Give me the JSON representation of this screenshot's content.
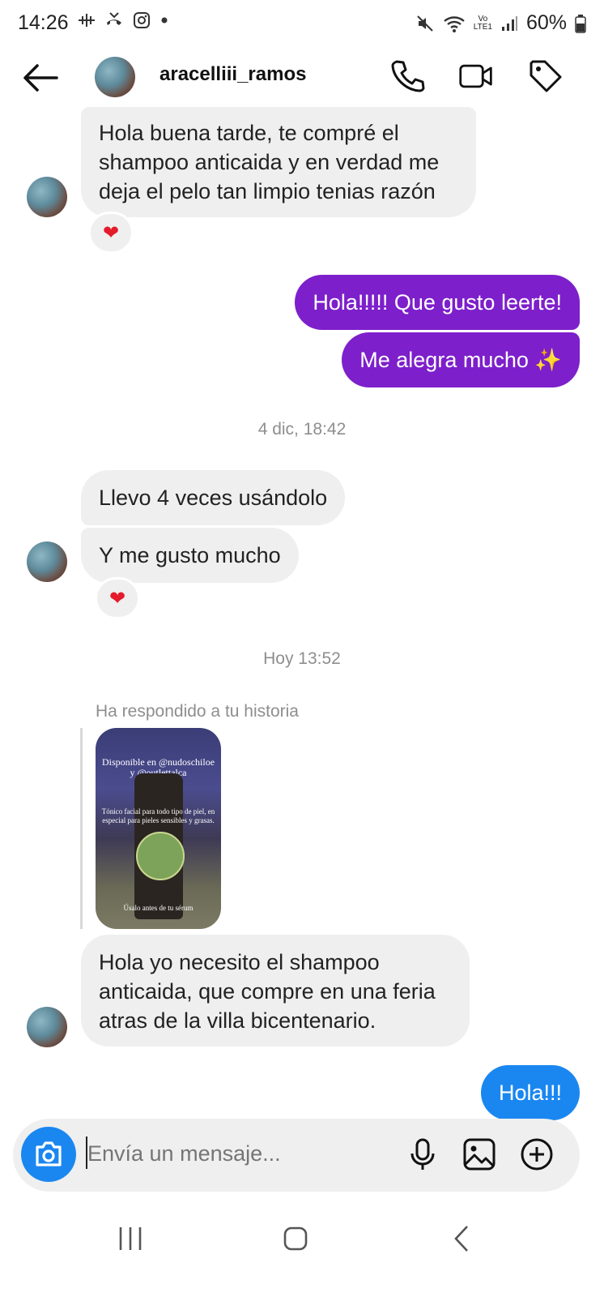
{
  "status_bar": {
    "time": "14:26",
    "volte": "Vo",
    "lte": "LTE1",
    "battery": "60%"
  },
  "header": {
    "username": "aracelliii_ramos"
  },
  "messages": {
    "m1": "Hola buena tarde, te compré el shampoo anticaida y en verdad me deja el pelo tan limpio tenias razón",
    "m1_reaction": "❤",
    "m2": "Hola!!!!! Que gusto leerte!",
    "m3": "Me alegra mucho ✨",
    "stamp1": "4 dic, 18:42",
    "m4": "Llevo 4 veces usándolo",
    "m5": "Y me gusto mucho",
    "m5_reaction": "❤",
    "stamp2": "Hoy 13:52",
    "story_reply_label": "Ha respondido a tu historia",
    "story": {
      "line1": "Disponible en @nudoschiloe y @outlettalca",
      "line2": "Tónico facial para todo tipo de piel, en especial para pieles sensibles y grasas.",
      "line3": "Úsalo antes de tu sérum"
    },
    "m6": "Hola yo necesito el shampoo anticaida, que compre en una feria atras de la villa bicentenario.",
    "m7": "Hola!!!"
  },
  "composer": {
    "placeholder": "Envía un mensaje..."
  },
  "colors": {
    "outgoing_bubble": "#7d1fcb",
    "last_outgoing_bubble": "#1a87f0",
    "incoming_bubble": "#efefef",
    "camera_button": "#1a87f0"
  },
  "icons": [
    "back-arrow-icon",
    "phone-icon",
    "video-icon",
    "tag-icon",
    "camera-icon",
    "microphone-icon",
    "gallery-icon",
    "plus-circle-icon",
    "recents-icon",
    "home-icon",
    "nav-back-icon"
  ]
}
